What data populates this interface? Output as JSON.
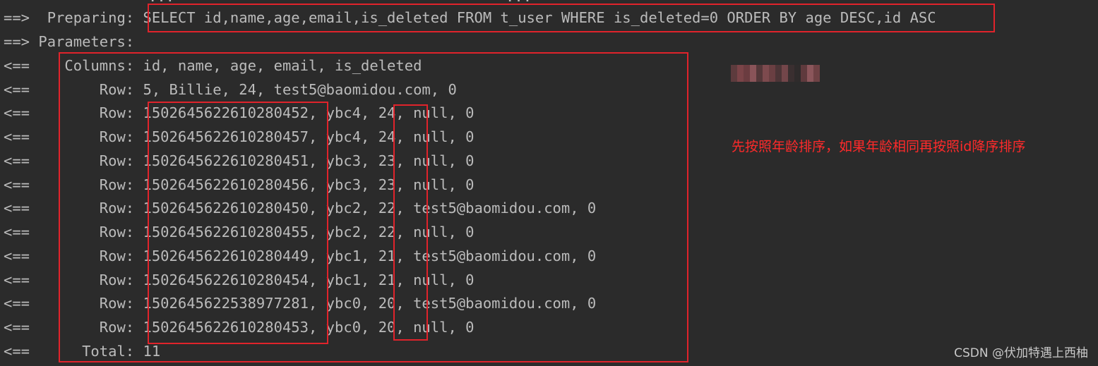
{
  "log": {
    "top_partial": "...                                      ...",
    "preparing_prefix": "==>  Preparing: ",
    "sql": "SELECT id,name,age,email,is_deleted FROM t_user WHERE is_deleted=0 ORDER BY age DESC,id ASC",
    "parameters_line": "==> Parameters: ",
    "arrow_in": "<==",
    "columns_label": "    Columns: ",
    "columns": "id, name, age, email, is_deleted",
    "row_label": "        Row: ",
    "rows": [
      "5, Billie, 24, test5@baomidou.com, 0",
      "1502645622610280452, ybc4, 24, null, 0",
      "1502645622610280457, ybc4, 24, null, 0",
      "1502645622610280451, ybc3, 23, null, 0",
      "1502645622610280456, ybc3, 23, null, 0",
      "1502645622610280450, ybc2, 22, test5@baomidou.com, 0",
      "1502645622610280455, ybc2, 22, null, 0",
      "1502645622610280449, ybc1, 21, test5@baomidou.com, 0",
      "1502645622610280454, ybc1, 21, null, 0",
      "1502645622538977281, ybc0, 20, test5@baomidou.com, 0",
      "1502645622610280453, ybc0, 20, null, 0"
    ],
    "total_label": "      Total: ",
    "total": "11"
  },
  "annotation": "先按照年龄排序，如果年龄相同再按照id降序排序",
  "watermark": "CSDN @伏加特遇上西柚",
  "colors": {
    "background": "#2b2b2b",
    "text": "#bbbbbb",
    "highlight_box": "#e0232b",
    "annotation": "#ff2a2a"
  }
}
